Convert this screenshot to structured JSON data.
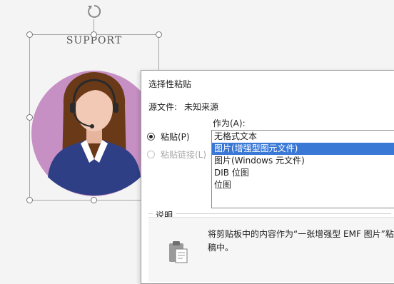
{
  "slide": {
    "picture_caption": "SUPPORT"
  },
  "dialog": {
    "title": "选择性粘贴",
    "source_label": "源文件:",
    "source_value": "未知来源",
    "as_label": "作为(A):",
    "options": [
      {
        "label": "粘贴(P)",
        "checked": true,
        "enabled": true
      },
      {
        "label": "粘贴链接(L)",
        "checked": false,
        "enabled": false
      }
    ],
    "formats": [
      {
        "label": "无格式文本",
        "selected": false
      },
      {
        "label": "图片(增强型图元文件)",
        "selected": true
      },
      {
        "label": "图片(Windows 元文件)",
        "selected": false
      },
      {
        "label": "DIB 位图",
        "selected": false
      },
      {
        "label": "位图",
        "selected": false
      }
    ],
    "description_label": "说明",
    "description_text": "将剪贴板中的内容作为“一张增强型 EMF 图片”粘稿中。"
  },
  "colors": {
    "selection_highlight": "#3a78d6",
    "avatar_background": "#c690c4",
    "shirt": "#2f3f86",
    "hair": "#6a3a18",
    "skin": "#f2c9b4"
  }
}
